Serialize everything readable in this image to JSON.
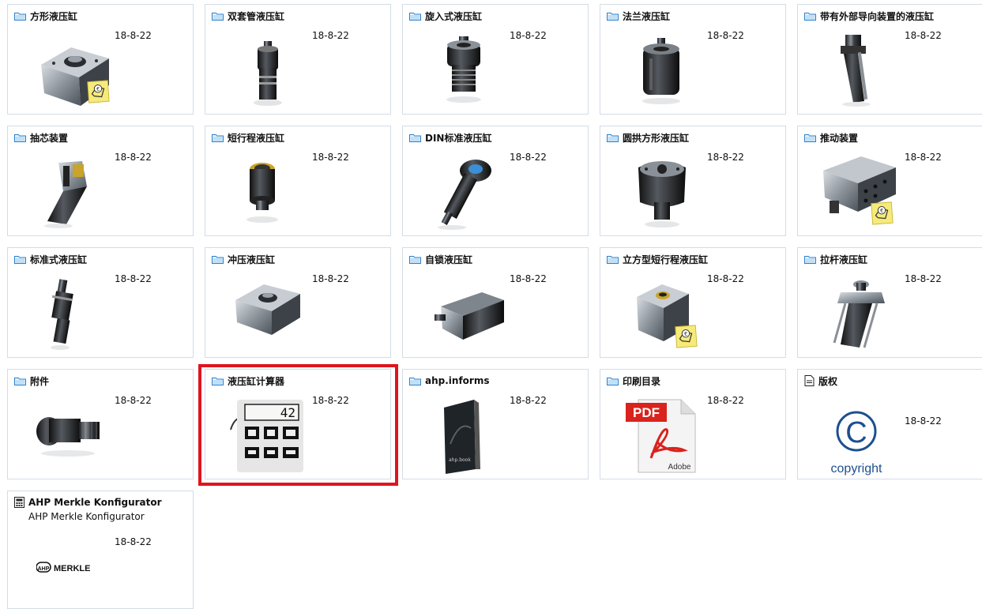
{
  "items": [
    {
      "title": "方形液压缸",
      "date": "18-8-22",
      "icon": "folder-icon"
    },
    {
      "title": "双套管液压缸",
      "date": "18-8-22",
      "icon": "folder-icon"
    },
    {
      "title": "旋入式液压缸",
      "date": "18-8-22",
      "icon": "folder-icon"
    },
    {
      "title": "法兰液压缸",
      "date": "18-8-22",
      "icon": "folder-icon"
    },
    {
      "title": "带有外部导向装置的液压缸",
      "date": "18-8-22",
      "icon": "folder-icon"
    },
    {
      "title": "抽芯装置",
      "date": "18-8-22",
      "icon": "folder-icon"
    },
    {
      "title": "短行程液压缸",
      "date": "18-8-22",
      "icon": "folder-icon"
    },
    {
      "title": "DIN标准液压缸",
      "date": "18-8-22",
      "icon": "folder-icon"
    },
    {
      "title": "圆拱方形液压缸",
      "date": "18-8-22",
      "icon": "folder-icon"
    },
    {
      "title": "推动装置",
      "date": "18-8-22",
      "icon": "folder-icon"
    },
    {
      "title": "标准式液压缸",
      "date": "18-8-22",
      "icon": "folder-icon"
    },
    {
      "title": "冲压液压缸",
      "date": "18-8-22",
      "icon": "folder-icon"
    },
    {
      "title": "自锁液压缸",
      "date": "18-8-22",
      "icon": "folder-icon"
    },
    {
      "title": "立方型短行程液压缸",
      "date": "18-8-22",
      "icon": "folder-icon"
    },
    {
      "title": "拉杆液压缸",
      "date": "18-8-22",
      "icon": "folder-icon"
    },
    {
      "title": "附件",
      "date": "18-8-22",
      "icon": "folder-icon"
    },
    {
      "title": "液压缸计算器",
      "date": "18-8-22",
      "icon": "folder-icon"
    },
    {
      "title": "ahp.informs",
      "date": "18-8-22",
      "icon": "folder-icon"
    },
    {
      "title": "印刷目录",
      "date": "18-8-22",
      "icon": "folder-icon"
    },
    {
      "title": "版权",
      "date": "18-8-22",
      "icon": "document-icon"
    },
    {
      "title": "AHP Merkle Konfigurator",
      "subtitle": "AHP Merkle Konfigurator",
      "date": "18-8-22",
      "icon": "calculator-icon"
    }
  ],
  "thumbs": {
    "calculator_display": "42",
    "pdf_label": "PDF",
    "adobe_label": "Adobe",
    "copyright_label": "copyright",
    "copyright_symbol": "C",
    "ahp_logo_text": "MERKLE",
    "ahp_logo_mark": "AHP",
    "book_label": "ahp.book"
  },
  "colors": {
    "highlight": "#e0141e",
    "folder": "#3b8fd6",
    "tile_border": "#d3dde6"
  }
}
